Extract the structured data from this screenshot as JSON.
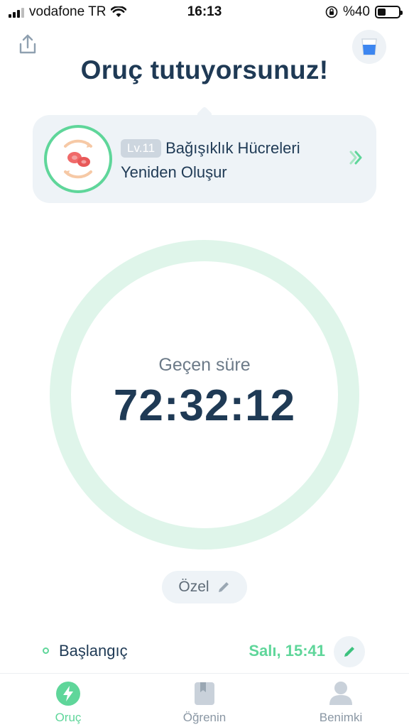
{
  "status_bar": {
    "carrier": "vodafone TR",
    "time": "16:13",
    "battery": "%40",
    "battery_level": 0.4
  },
  "header": {
    "title": "Oruç tutuyorsunuz!"
  },
  "stage": {
    "level": "Lv.11",
    "title": "Bağışıklık Hücreleri Yeniden Oluşur"
  },
  "timer": {
    "label": "Geçen süre",
    "value": "72:32:12"
  },
  "plan": {
    "label": "Özel"
  },
  "start": {
    "label": "Başlangıç",
    "value": "Salı, 15:41"
  },
  "tabs": [
    {
      "label": "Oruç",
      "icon": "bolt-icon",
      "active": true
    },
    {
      "label": "Öğrenin",
      "icon": "book-icon",
      "active": false
    },
    {
      "label": "Benimki",
      "icon": "user-icon",
      "active": false
    }
  ],
  "colors": {
    "accent": "#5fd69a",
    "ring": "#dff5ea",
    "text_dark": "#1f3a55",
    "card_bg": "#eef3f7"
  }
}
